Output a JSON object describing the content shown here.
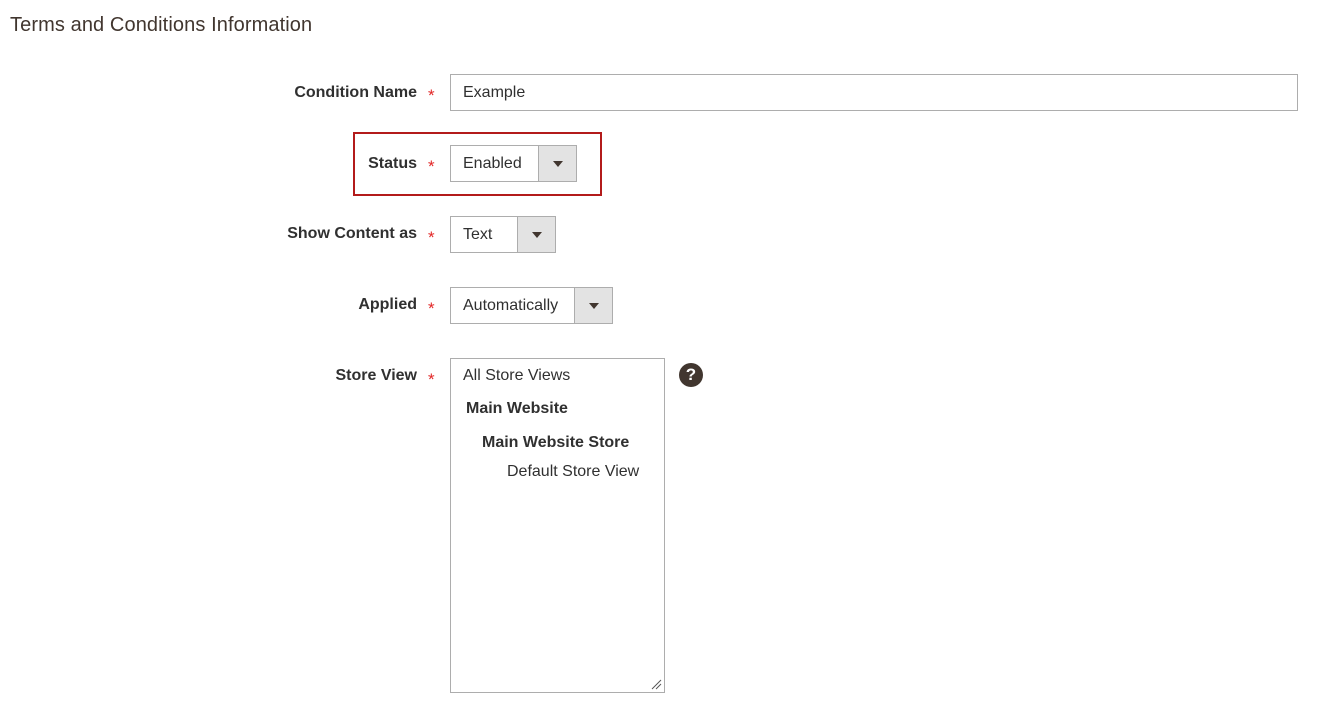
{
  "section": {
    "title": "Terms and Conditions Information"
  },
  "required_marker": "*",
  "fields": {
    "condition_name": {
      "label": "Condition Name",
      "value": "Example"
    },
    "status": {
      "label": "Status",
      "value": "Enabled"
    },
    "show_content_as": {
      "label": "Show Content as",
      "value": "Text"
    },
    "applied": {
      "label": "Applied",
      "value": "Automatically"
    },
    "store_view": {
      "label": "Store View",
      "options": [
        {
          "label": "All Store Views"
        },
        {
          "label": "Main Website"
        },
        {
          "label": "Main Website Store"
        },
        {
          "label": "Default Store View"
        }
      ]
    }
  },
  "help_icon": {
    "glyph": "?"
  },
  "colors": {
    "required": "#e22626",
    "highlight": "#b31b1b",
    "select_button": "#e3e3e3",
    "border": "#adadad"
  }
}
